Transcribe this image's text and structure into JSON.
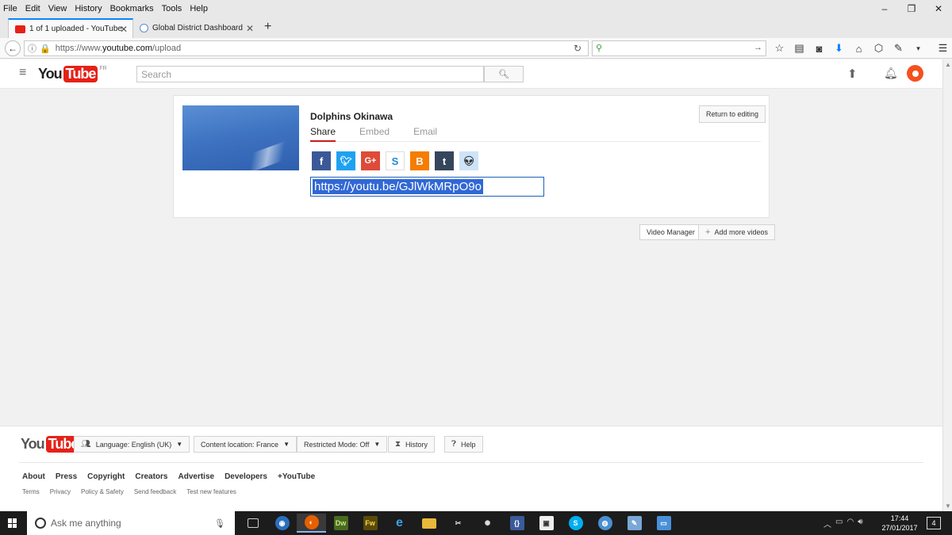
{
  "menubar": {
    "items": [
      "File",
      "Edit",
      "View",
      "History",
      "Bookmarks",
      "Tools",
      "Help"
    ]
  },
  "window": {
    "minimize": "–",
    "restore": "❐",
    "close": "✕"
  },
  "tabs": [
    {
      "label": "1 of 1 uploaded - YouTube",
      "active": true
    },
    {
      "label": "Global District Dashboard",
      "active": false
    }
  ],
  "urlbar": {
    "prefix": "https://www.",
    "domain": "youtube.com",
    "path": "/upload"
  },
  "yt": {
    "logo_you": "You",
    "logo_tube": "Tube",
    "logo_country": "FR",
    "search_placeholder": "Search"
  },
  "card": {
    "video_title": "Dolphins Okinawa",
    "tabs": [
      "Share",
      "Embed",
      "Email"
    ],
    "share_url": "https://youtu.be/GJlWkMRpO9o",
    "return_label": "Return to editing",
    "social": [
      {
        "icon": "facebook-icon",
        "glyph": "f",
        "color": "#3b5998"
      },
      {
        "icon": "twitter-icon",
        "glyph": "🐦",
        "color": "#1da1f2"
      },
      {
        "icon": "google-plus-icon",
        "glyph": "G+",
        "color": "#dd4b39"
      },
      {
        "icon": "stumbleupon-icon",
        "glyph": "S",
        "color": "#ffffff"
      },
      {
        "icon": "blogger-icon",
        "glyph": "B",
        "color": "#f57d00"
      },
      {
        "icon": "tumblr-icon",
        "glyph": "t",
        "color": "#35465c"
      },
      {
        "icon": "reddit-icon",
        "glyph": "👽",
        "color": "#cee3f8"
      }
    ]
  },
  "actions": {
    "video_manager": "Video Manager",
    "add_more": "Add more videos"
  },
  "footer": {
    "language": "Language: English (UK)",
    "content_location": "Content location: France",
    "restricted": "Restricted Mode: Off",
    "history": "History",
    "help": "Help",
    "links_primary": [
      "About",
      "Press",
      "Copyright",
      "Creators",
      "Advertise",
      "Developers",
      "+YouTube"
    ],
    "links_secondary": [
      "Terms",
      "Privacy",
      "Policy & Safety",
      "Send feedback",
      "Test new features"
    ]
  },
  "taskbar": {
    "search_placeholder": "Ask me anything",
    "time": "17:44",
    "date": "27/01/2017",
    "notification_count": "4"
  }
}
